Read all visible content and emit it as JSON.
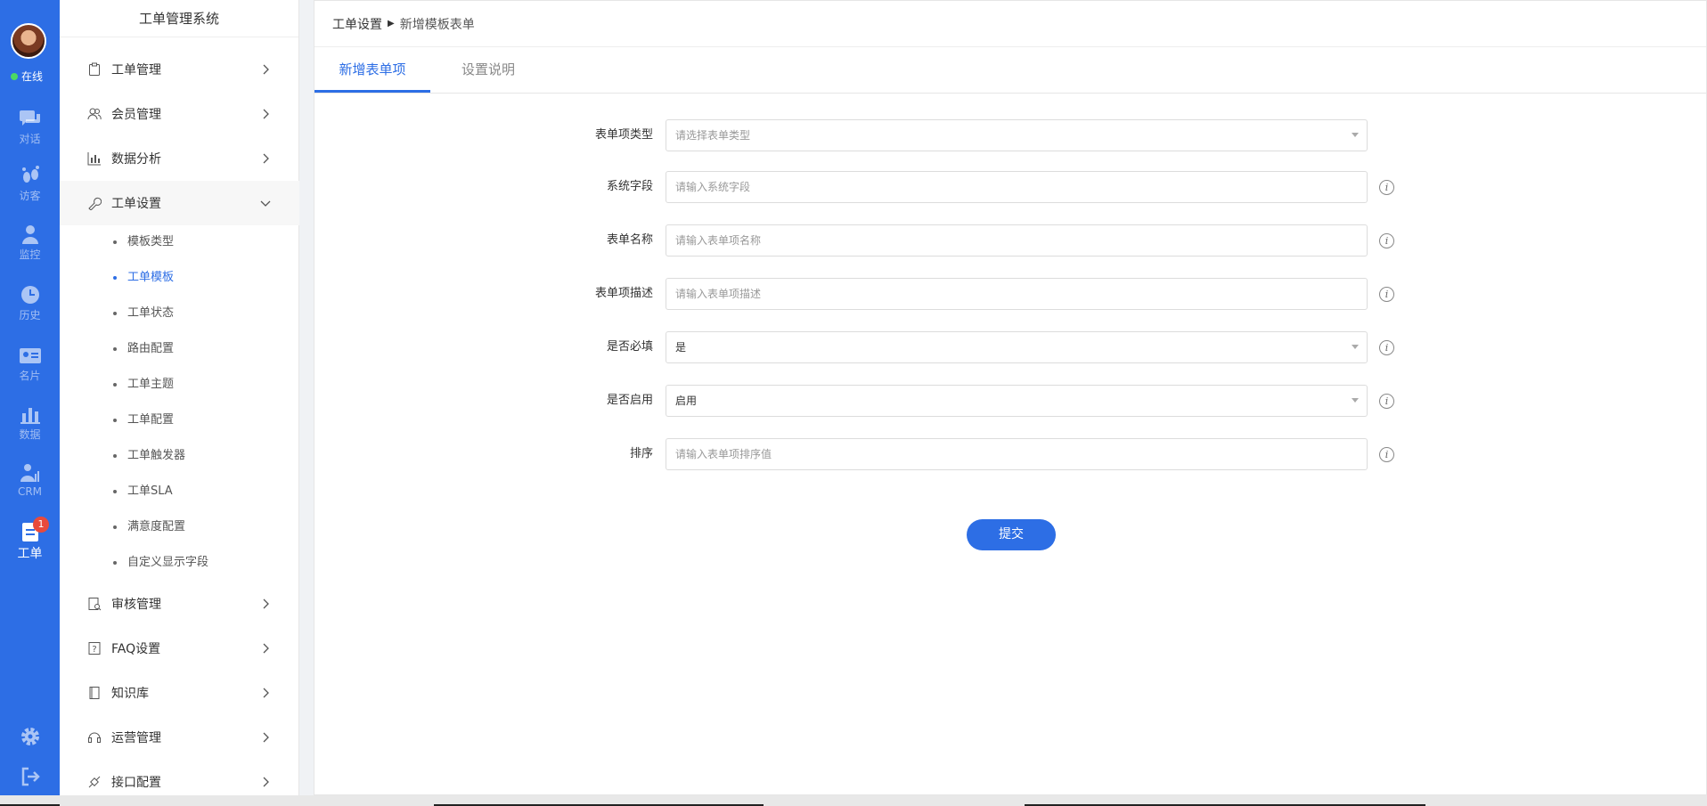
{
  "rail": {
    "status": "在线",
    "items": [
      {
        "label": "对话",
        "icon": "chat-icon"
      },
      {
        "label": "访客",
        "icon": "footprint-icon"
      },
      {
        "label": "监控",
        "icon": "monitor-user-icon"
      },
      {
        "label": "历史",
        "icon": "clock-icon"
      },
      {
        "label": "名片",
        "icon": "card-icon"
      },
      {
        "label": "数据",
        "icon": "bar-chart-icon"
      },
      {
        "label": "CRM",
        "icon": "crm-icon"
      },
      {
        "label": "工单",
        "icon": "ticket-icon",
        "badge": "1"
      }
    ],
    "settings_icon": "gear-icon",
    "logout_icon": "logout-icon",
    "colors": {
      "rail": "#2d6ee5",
      "accent": "#2d6ee5",
      "badge": "#e84a3c",
      "online": "#4cd964"
    }
  },
  "sidebar": {
    "title": "工单管理系统",
    "menu": [
      {
        "label": "工单管理"
      },
      {
        "label": "会员管理"
      },
      {
        "label": "数据分析"
      },
      {
        "label": "工单设置"
      }
    ],
    "submenu": [
      {
        "label": "模板类型"
      },
      {
        "label": "工单模板"
      },
      {
        "label": "工单状态"
      },
      {
        "label": "路由配置"
      },
      {
        "label": "工单主题"
      },
      {
        "label": "工单配置"
      },
      {
        "label": "工单触发器"
      },
      {
        "label": "工单SLA"
      },
      {
        "label": "满意度配置"
      },
      {
        "label": "自定义显示字段"
      }
    ],
    "menu_bottom": [
      {
        "label": "审核管理"
      },
      {
        "label": "FAQ设置"
      },
      {
        "label": "知识库"
      },
      {
        "label": "运营管理"
      },
      {
        "label": "接口配置"
      }
    ]
  },
  "breadcrumb": {
    "parent": "工单设置",
    "current": "新增模板表单"
  },
  "tabs": [
    {
      "label": "新增表单项"
    },
    {
      "label": "设置说明"
    }
  ],
  "form": {
    "type": {
      "label": "表单项类型",
      "placeholder": "请选择表单类型"
    },
    "system_field": {
      "label": "系统字段",
      "placeholder": "请输入系统字段"
    },
    "name": {
      "label": "表单名称",
      "placeholder": "请输入表单项名称"
    },
    "description": {
      "label": "表单项描述",
      "placeholder": "请输入表单项描述"
    },
    "required": {
      "label": "是否必填",
      "value": "是"
    },
    "enabled": {
      "label": "是否启用",
      "value": "启用"
    },
    "sort": {
      "label": "排序",
      "placeholder": "请输入表单项排序值"
    },
    "submit": "提交",
    "info_glyph": "i"
  }
}
